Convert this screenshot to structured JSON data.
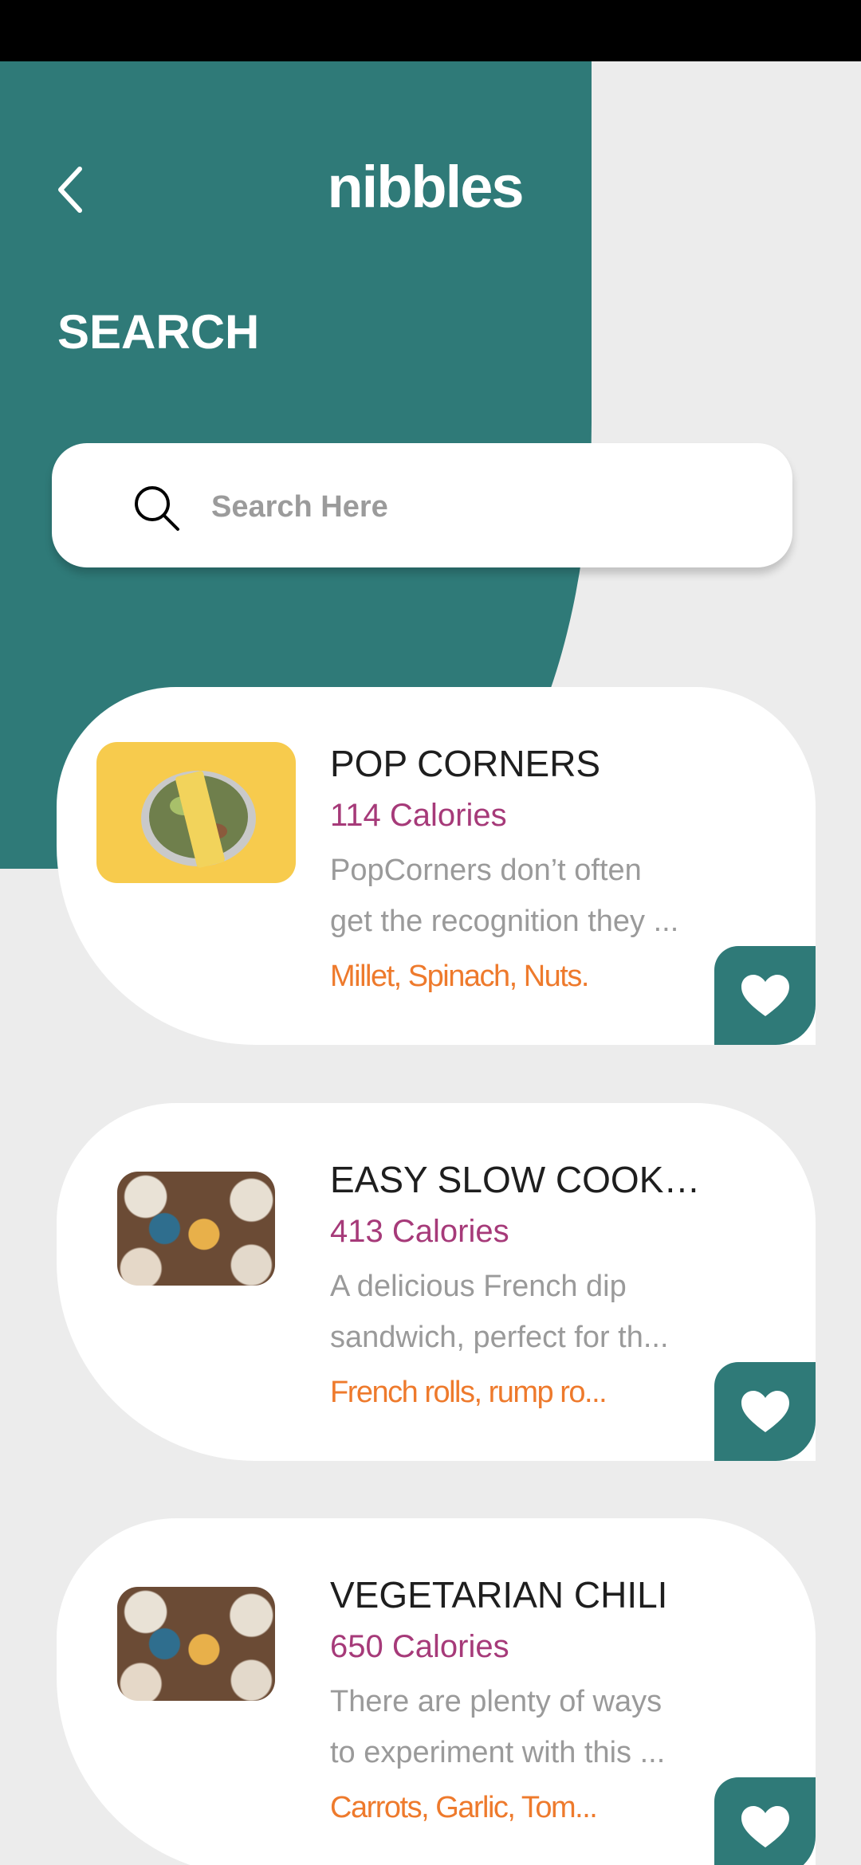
{
  "colors": {
    "teal": "#2F7A78",
    "calories": "#A63A79",
    "ingredients": "#EE7A2C",
    "description": "#9A9A9A",
    "background": "#ECECEC"
  },
  "header": {
    "back_icon": "chevron-left-icon",
    "logo": "nibbles",
    "title": "SEARCH"
  },
  "search": {
    "icon": "search-icon",
    "placeholder": "Search Here"
  },
  "results": [
    {
      "title": "POP CORNERS",
      "calories": "114 Calories",
      "description_line1": "PopCorners don’t often",
      "description_line2": "get the recognition they ...",
      "ingredients": "Millet, Spinach, Nuts.",
      "favorite_icon": "heart-icon"
    },
    {
      "title": "EASY SLOW COOKE...",
      "calories": "413 Calories",
      "description_line1": "A delicious French dip",
      "description_line2": "sandwich, perfect for th...",
      "ingredients": "French rolls, rump ro...",
      "favorite_icon": "heart-icon"
    },
    {
      "title": "VEGETARIAN CHILI",
      "calories": "650 Calories",
      "description_line1": "There are plenty of ways",
      "description_line2": "to experiment with this ...",
      "ingredients": "Carrots, Garlic, Tom...",
      "favorite_icon": "heart-icon"
    }
  ]
}
